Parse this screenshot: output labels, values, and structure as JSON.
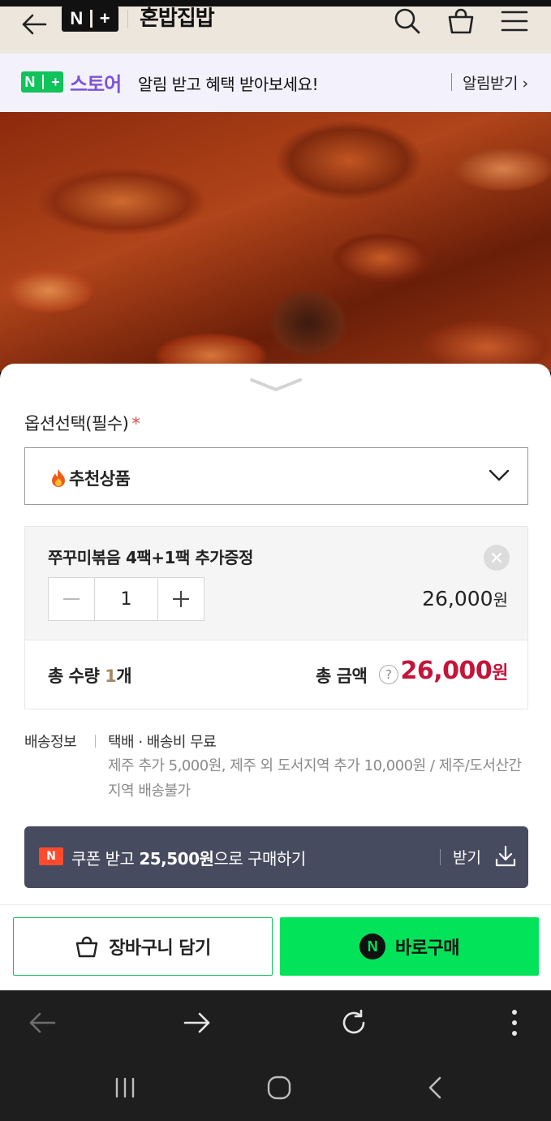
{
  "header": {
    "logo_left": "N",
    "logo_right": "+",
    "store_name": "혼밥집밥",
    "icons": [
      "back-arrow-icon",
      "search-icon",
      "cart-icon",
      "menu-icon"
    ]
  },
  "banner": {
    "badge_left": "N",
    "badge_right": "+",
    "store_label": "스토어",
    "message": "알림 받고 혜택 받아보세요!",
    "link": "알림받기 ›"
  },
  "options": {
    "label": "옵션선택(필수)",
    "required_mark": "*",
    "selected_value": "추천상품"
  },
  "item": {
    "name": "쭈꾸미볶음 4팩+1팩 추가증정",
    "quantity": "1",
    "price": "26,000",
    "currency": "원"
  },
  "total": {
    "qty_prefix": "총 수량 ",
    "qty_value": "1",
    "qty_unit": "개",
    "amount_label": "총 금액",
    "help": "?",
    "amount": "26,000",
    "currency": "원"
  },
  "shipping": {
    "label": "배송정보",
    "method": "택배 · 배송비 무료",
    "note": "제주 추가 5,000원, 제주 외 도서지역 추가 10,000원 / 제주/도서산간 지역 배송불가"
  },
  "coupon": {
    "badge": "N",
    "text_prefix": "쿠폰 받고 ",
    "text_amount": "25,500원",
    "text_suffix": "으로 구매하기",
    "action": "받기"
  },
  "actions": {
    "cart_label": "장바구니 담기",
    "buy_badge": "N",
    "buy_label": "바로구매"
  },
  "colors": {
    "header_bg": "#ece6dc",
    "banner_bg": "#f3f1fb",
    "store_purple": "#7b54d6",
    "naver_green": "#03e35a",
    "price_red": "#c3153a",
    "coupon_bg": "#474b5f"
  }
}
